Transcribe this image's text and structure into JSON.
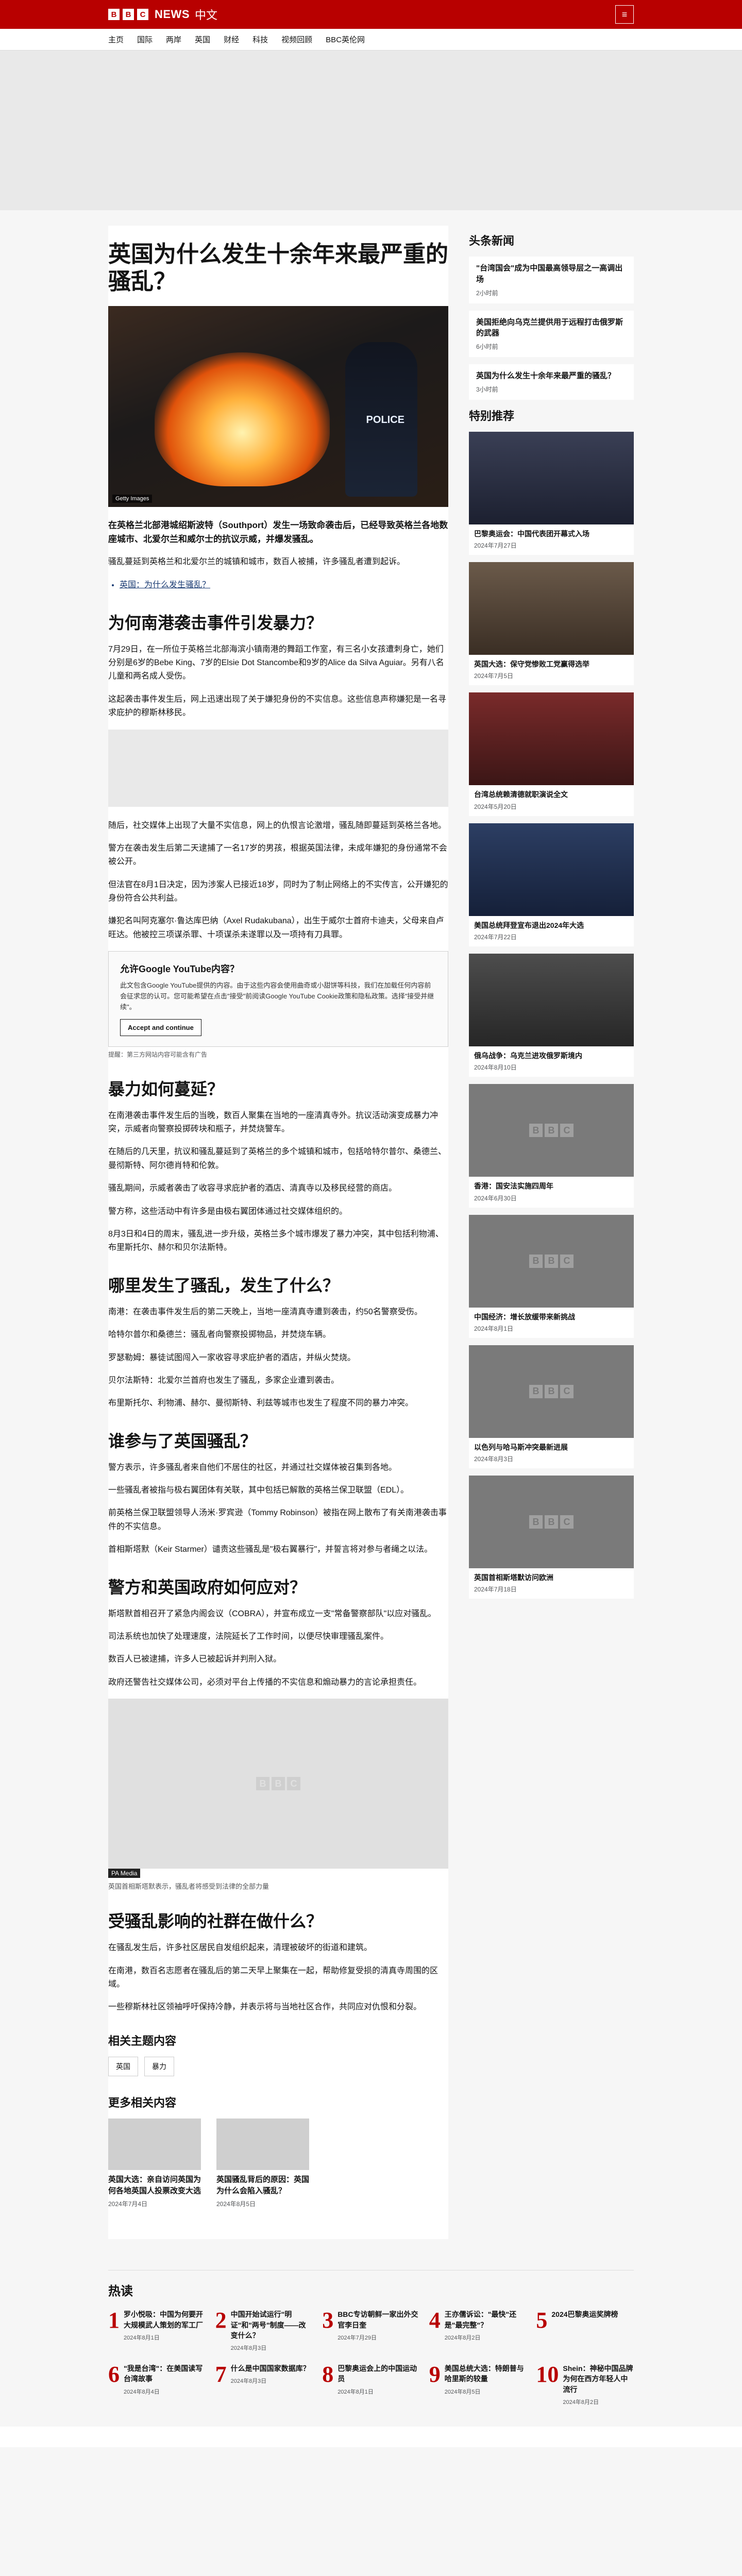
{
  "header": {
    "brand": "NEWS",
    "brand_lang": "中文",
    "menu_icon": "menu-icon"
  },
  "nav": [
    "主页",
    "国际",
    "两岸",
    "英国",
    "财经",
    "科技",
    "视频回顾",
    "BBC英伦网"
  ],
  "article": {
    "title": "英国为什么发生十余年来最严重的骚乱？",
    "hero_credit": "Getty Images",
    "hero_caption": "",
    "police_label": "POLICE",
    "lede": "在英格兰北部港城绍斯波特（Southport）发生一场致命袭击后，已经导致英格兰各地数座城市、北爱尔兰和威尔士的抗议示威，并爆发骚乱。",
    "p1": "骚乱蔓延到英格兰和北爱尔兰的城镇和城市，数百人被捕，许多骚乱者遭到起诉。",
    "links": [
      "英国：为什么发生骚乱？"
    ],
    "h2_1": "为何南港袭击事件引发暴力？",
    "p2": "7月29日，在一所位于英格兰北部海滨小镇南港的舞蹈工作室，有三名小女孩遭刺身亡，她们分别是6岁的Bebe King、7岁的Elsie Dot Stancombe和9岁的Alice da Silva Aguiar。另有八名儿童和两名成人受伤。",
    "p3": "这起袭击事件发生后，网上迅速出现了关于嫌犯身份的不实信息。这些信息声称嫌犯是一名寻求庇护的穆斯林移民。",
    "p4": "随后，社交媒体上出现了大量不实信息，网上的仇恨言论激增，骚乱随即蔓延到英格兰各地。",
    "p5": "警方在袭击发生后第二天逮捕了一名17岁的男孩，根据英国法律，未成年嫌犯的身份通常不会被公开。",
    "p6": "但法官在8月1日决定，因为涉案人已接近18岁，同时为了制止网络上的不实传言，公开嫌犯的身份符合公共利益。",
    "p7": "嫌犯名叫阿克塞尔·鲁达库巴纳（Axel Rudakubana），出生于威尔士首府卡迪夫，父母来自卢旺达。他被控三项谋杀罪、十项谋杀未遂罪以及一项持有刀具罪。",
    "yt_title": "允许Google YouTube内容？",
    "yt_text": "此文包含Google YouTube提供的内容。由于这些内容会使用曲奇或小甜饼等科技，我们在加载任何内容前会征求您的认可。您可能希望在点击\"接受\"前阅读Google YouTube Cookie政策和隐私政策。选择\"接受并继续\"。",
    "yt_button": "Accept and continue",
    "yt_note": "提醒：第三方网站内容可能含有广告",
    "h2_2": "暴力如何蔓延？",
    "p8": "在南港袭击事件发生后的当晚，数百人聚集在当地的一座清真寺外。抗议活动演变成暴力冲突，示威者向警察投掷砖块和瓶子，并焚烧警车。",
    "p9": "在随后的几天里，抗议和骚乱蔓延到了英格兰的多个城镇和城市，包括哈特尔普尔、桑德兰、曼彻斯特、阿尔德肖特和伦敦。",
    "p10": "骚乱期间，示威者袭击了收容寻求庇护者的酒店、清真寺以及移民经营的商店。",
    "p11": "警方称，这些活动中有许多是由极右翼团体通过社交媒体组织的。",
    "p12": "8月3日和4日的周末，骚乱进一步升级，英格兰多个城市爆发了暴力冲突，其中包括利物浦、布里斯托尔、赫尔和贝尔法斯特。",
    "h2_3": "哪里发生了骚乱，发生了什么？",
    "p13": "南港：在袭击事件发生后的第二天晚上，当地一座清真寺遭到袭击，约50名警察受伤。",
    "p14": "哈特尔普尔和桑德兰：骚乱者向警察投掷物品，并焚烧车辆。",
    "p15": "罗瑟勒姆：暴徒试图闯入一家收容寻求庇护者的酒店，并纵火焚烧。",
    "p16": "贝尔法斯特：北爱尔兰首府也发生了骚乱，多家企业遭到袭击。",
    "p17": "布里斯托尔、利物浦、赫尔、曼彻斯特、利兹等城市也发生了程度不同的暴力冲突。",
    "h2_4": "谁参与了英国骚乱？",
    "p18": "警方表示，许多骚乱者来自他们不居住的社区，并通过社交媒体被召集到各地。",
    "p19": "一些骚乱者被指与极右翼团体有关联，其中包括已解散的英格兰保卫联盟（EDL）。",
    "p20": "前英格兰保卫联盟领导人汤米·罗宾逊（Tommy Robinson）被指在网上散布了有关南港袭击事件的不实信息。",
    "p21": "首相斯塔默（Keir Starmer）谴责这些骚乱是\"极右翼暴行\"，并誓言将对参与者绳之以法。",
    "h2_5": "警方和英国政府如何应对？",
    "p22": "斯塔默首相召开了紧急内阁会议（COBRA），并宣布成立一支\"常备警察部队\"以应对骚乱。",
    "p23": "司法系统也加快了处理速度，法院延长了工作时间，以便尽快审理骚乱案件。",
    "p24": "数百人已被逮捕，许多人已被起诉并判刑入狱。",
    "p25": "政府还警告社交媒体公司，必须对平台上传播的不实信息和煽动暴力的言论承担责任。",
    "img_caption_tag": "PA Media",
    "img_caption": "英国首相斯塔默表示，骚乱者将感受到法律的全部力量",
    "h2_6": "受骚乱影响的社群在做什么？",
    "p26": "在骚乱发生后，许多社区居民自发组织起来，清理被破坏的街道和建筑。",
    "p27": "在南港，数百名志愿者在骚乱后的第二天早上聚集在一起，帮助修复受损的清真寺周围的区域。",
    "p28": "一些穆斯林社区领袖呼吁保持冷静，并表示将与当地社区合作，共同应对仇恨和分裂。"
  },
  "related": {
    "heading": "相关主题内容",
    "tags": [
      "英国",
      "暴力"
    ],
    "more_heading": "更多相关内容",
    "cards": [
      {
        "title": "英国大选：亲自访问英国为何各地英国人投票改变大选",
        "date": "2024年7月4日"
      },
      {
        "title": "英国骚乱背后的原因：英国为什么会陷入骚乱？",
        "date": "2024年8月5日"
      }
    ]
  },
  "sidebar": {
    "top_heading": "头条新闻",
    "top_news": [
      {
        "title": "\"台湾国会\"成为中国最高领导层之一高调出场",
        "date": "2小时前"
      },
      {
        "title": "美国拒绝向乌克兰提供用于远程打击俄罗斯的武器",
        "date": "6小时前"
      },
      {
        "title": "英国为什么发生十余年来最严重的骚乱？",
        "date": "3小时前"
      }
    ],
    "rec_heading": "特别推荐",
    "recs": [
      {
        "title": "巴黎奥运会：中国代表团开幕式入场",
        "date": "2024年7月27日"
      },
      {
        "title": "英国大选：保守党惨败工党赢得选举",
        "date": "2024年7月5日"
      },
      {
        "title": "台湾总统赖清德就职演说全文",
        "date": "2024年5月20日"
      },
      {
        "title": "美国总统拜登宣布退出2024年大选",
        "date": "2024年7月22日"
      },
      {
        "title": "俄乌战争：乌克兰进攻俄罗斯境内",
        "date": "2024年8月10日"
      },
      {
        "title": "香港：国安法实施四周年",
        "date": "2024年6月30日"
      },
      {
        "title": "中国经济：增长放缓带来新挑战",
        "date": "2024年8月1日"
      },
      {
        "title": "以色列与哈马斯冲突最新进展",
        "date": "2024年8月3日"
      },
      {
        "title": "英国首相斯塔默访问欧洲",
        "date": "2024年7月18日"
      }
    ]
  },
  "trending": {
    "heading": "热读",
    "items": [
      {
        "n": "1",
        "title": "罗小悦吸：中国为何要开大规模武人策划的军工厂",
        "date": "2024年8月1日"
      },
      {
        "n": "2",
        "title": "中国开始试运行\"明证\"和\"两号\"制度——改变什么？",
        "date": "2024年8月3日"
      },
      {
        "n": "3",
        "title": "BBC专访朝鲜一家出外交官李日奎",
        "date": "2024年7月29日"
      },
      {
        "n": "4",
        "title": "王亦儒诉讼：\"最快\"还是\"最完整\"？",
        "date": "2024年8月2日"
      },
      {
        "n": "5",
        "title": "2024巴黎奥运奖牌榜",
        "date": ""
      },
      {
        "n": "6",
        "title": "\"我是台湾\"：在美国读写台湾故事",
        "date": "2024年8月4日"
      },
      {
        "n": "7",
        "title": "什么是中国国家数据库？",
        "date": "2024年8月3日"
      },
      {
        "n": "8",
        "title": "巴黎奥运会上的中国运动员",
        "date": "2024年8月1日"
      },
      {
        "n": "9",
        "title": "美国总统大选：特朗普与哈里斯的较量",
        "date": "2024年8月5日"
      },
      {
        "n": "10",
        "title": "Shein：神秘中国品牌为何在西方年轻人中流行",
        "date": "2024年8月2日"
      }
    ]
  }
}
